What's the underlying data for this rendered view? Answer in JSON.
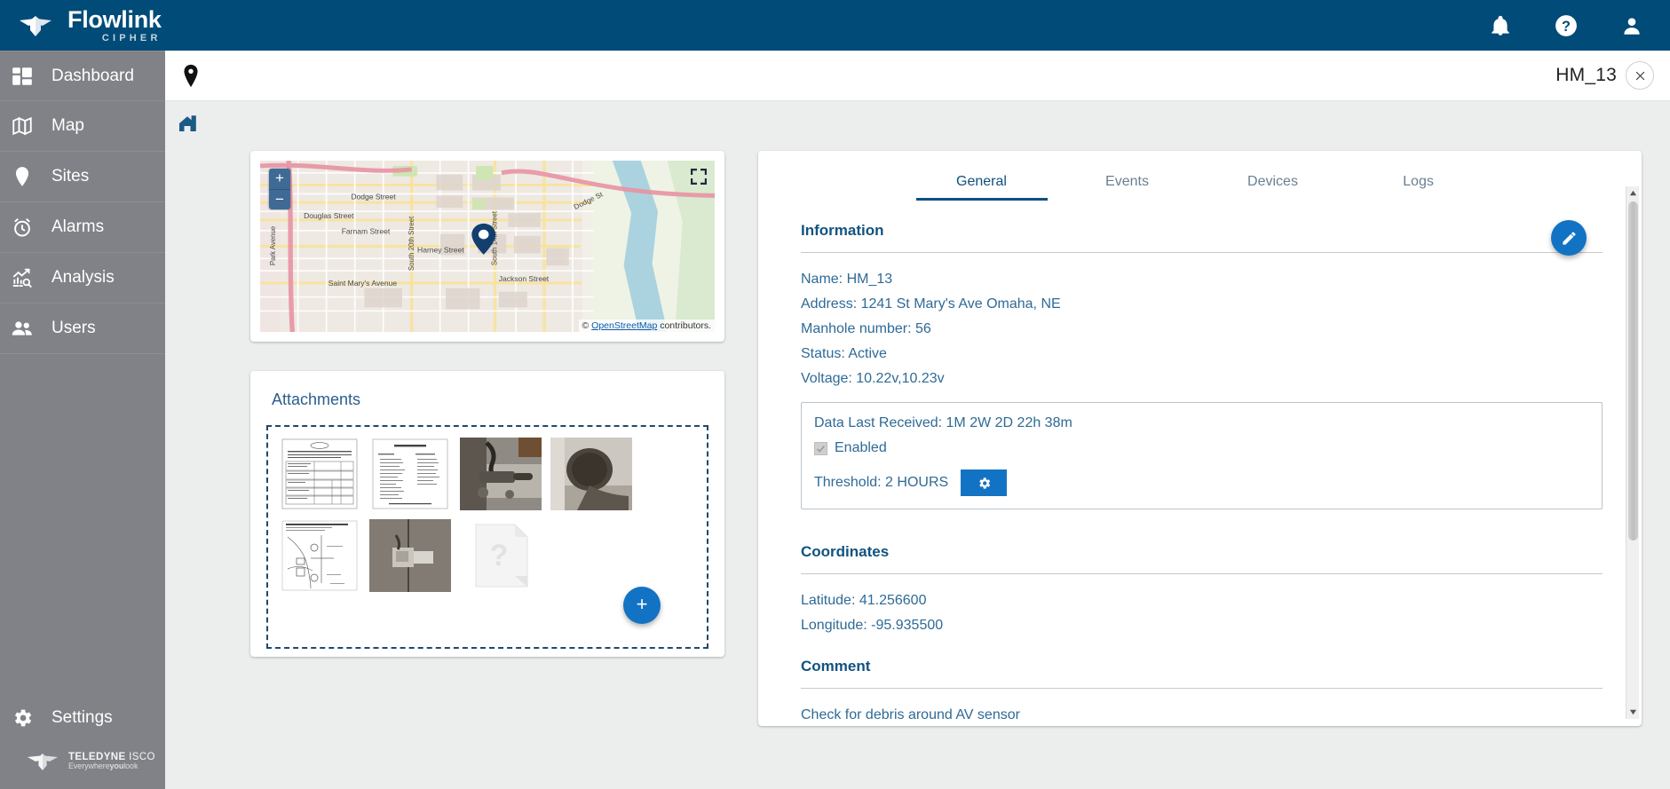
{
  "brand": {
    "name": "Flowlink",
    "sub": "CIPHER",
    "mark": "flowlink-logo"
  },
  "topbar": {
    "icons": [
      {
        "name": "notifications-icon",
        "label": "Notifications"
      },
      {
        "name": "help-icon",
        "label": "Help"
      },
      {
        "name": "account-icon",
        "label": "Account"
      }
    ]
  },
  "sidebar": {
    "items": [
      {
        "label": "Dashboard",
        "icon": "dashboard-icon"
      },
      {
        "label": "Map",
        "icon": "map-icon"
      },
      {
        "label": "Sites",
        "icon": "location-pin-icon"
      },
      {
        "label": "Alarms",
        "icon": "alarm-clock-icon"
      },
      {
        "label": "Analysis",
        "icon": "chart-search-icon"
      },
      {
        "label": "Users",
        "icon": "users-icon"
      }
    ],
    "settings": {
      "label": "Settings",
      "icon": "gear-icon"
    },
    "footer": {
      "brand": "TELEDYNE",
      "brand2": "ISCO",
      "tagline_1": "Everywhere",
      "tagline_2": "you",
      "tagline_3": "look"
    }
  },
  "pagebar": {
    "pin_icon": "location-pin-icon",
    "title": "HM_13",
    "close_label": "×"
  },
  "breadcrumb": {
    "home_icon": "home-site-icon"
  },
  "map": {
    "zoom_in": "+",
    "zoom_out": "−",
    "fullscreen_icon": "fullscreen-icon",
    "marker": "site-marker",
    "attribution_prefix": "© ",
    "attribution_link": "OpenStreetMap",
    "attribution_suffix": " contributors.",
    "streets": [
      "Dodge Street",
      "Douglas Street",
      "Farnam Street",
      "Harney Street",
      "Saint Mary's Avenue",
      "Jackson Street",
      "Park Avenue",
      "South 20th Street",
      "South 14th Street",
      "Dodge Street"
    ]
  },
  "attachments": {
    "title": "Attachments",
    "add_label": "+",
    "row1": [
      {
        "name": "document-thumbnail",
        "kind": "form"
      },
      {
        "name": "document-thumbnail",
        "kind": "toollist"
      },
      {
        "name": "photo-thumbnail",
        "kind": "photo-sensor"
      },
      {
        "name": "photo-thumbnail",
        "kind": "photo-pipe"
      }
    ],
    "row2": [
      {
        "name": "document-thumbnail",
        "kind": "siteplan"
      },
      {
        "name": "photo-thumbnail",
        "kind": "photo-wall"
      },
      {
        "name": "unknown-file-thumbnail",
        "kind": "unknown"
      }
    ]
  },
  "detail": {
    "tabs": [
      {
        "label": "General",
        "active": true
      },
      {
        "label": "Events",
        "active": false
      },
      {
        "label": "Devices",
        "active": false
      },
      {
        "label": "Logs",
        "active": false
      }
    ],
    "edit_icon": "pencil-edit-icon",
    "information": {
      "heading": "Information",
      "rows": [
        "Name: HM_13",
        "Address: 1241 St Mary's Ave Omaha, NE",
        "Manhole number: 56",
        "Status: Active",
        "Voltage: 10.22v,10.23v"
      ]
    },
    "data_last_received": {
      "line": "Data Last Received: 1M 2W 2D 22h 38m",
      "enabled_label": "Enabled",
      "enabled_checked": true,
      "threshold_label": "Threshold: 2 HOURS",
      "settings_icon": "gear-icon"
    },
    "coordinates": {
      "heading": "Coordinates",
      "latitude": "Latitude: 41.256600",
      "longitude": "Longitude: -95.935500"
    },
    "comment": {
      "heading": "Comment",
      "text": "Check for debris around AV sensor"
    }
  },
  "colors": {
    "header_blue": "#004b77",
    "sidebar_gray": "#808287",
    "accent_blue": "#1273c4",
    "text_blue": "#2f6a96",
    "heading_blue": "#12537f"
  }
}
